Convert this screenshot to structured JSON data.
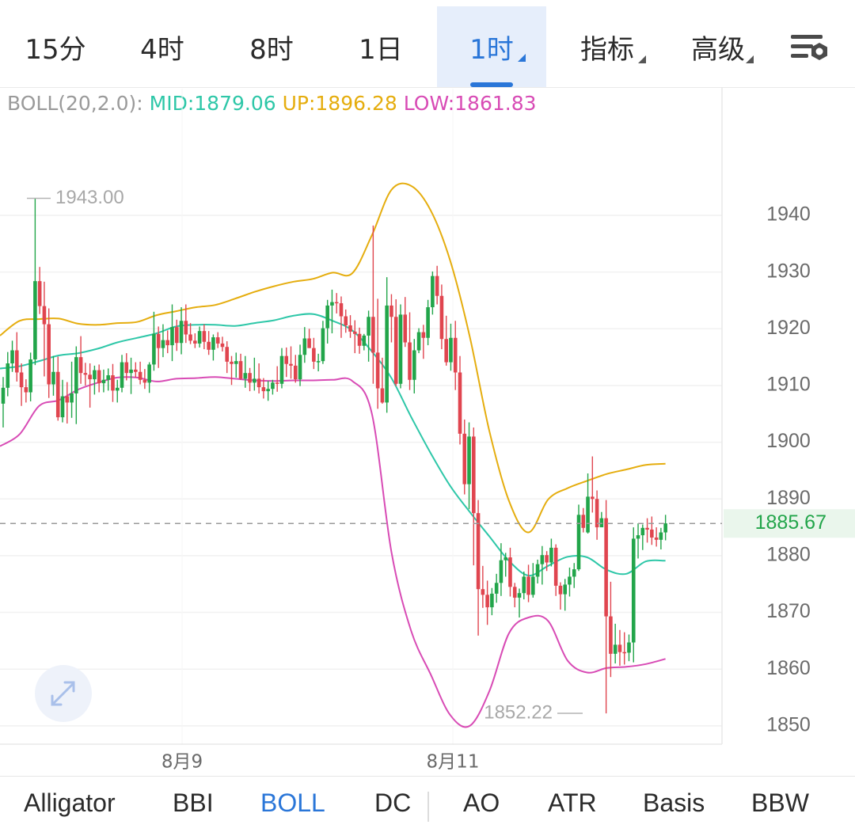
{
  "timeframe_tabs": [
    {
      "label": "15分"
    },
    {
      "label": "4时"
    },
    {
      "label": "8时"
    },
    {
      "label": "1日"
    },
    {
      "label": "1时",
      "active": true
    },
    {
      "label": "指标"
    },
    {
      "label": "高级"
    }
  ],
  "settings_icon": "chart-settings-gear-icon",
  "indicator_legend": {
    "name": "BOLL(20,2.0):",
    "mid": "MID:1879.06",
    "up": "UP:1896.28",
    "low": "LOW:1861.83"
  },
  "colors": {
    "up_candle": "#22a54a",
    "down_candle": "#e0454f",
    "mid_line": "#2ec7a8",
    "upper_band": "#e5ad0e",
    "lower_band": "#d84bb5",
    "active_tab": "#2a76d8",
    "last_price": "#22a54a"
  },
  "chart_data": {
    "type": "candlestick",
    "interval": "1时",
    "ylim": [
      1846,
      1954
    ],
    "y_ticks": [
      "1940",
      "1930",
      "1920",
      "1910",
      "1900",
      "1890",
      "1880",
      "1870",
      "1860",
      "1850"
    ],
    "x_labels": [
      "8月9",
      "8月11"
    ],
    "high_marker": "1943.00",
    "low_marker": "1852.22",
    "last_price": "1885.67",
    "candles": [
      [
        1906.8,
        1911.5,
        1902.6,
        1909.6
      ],
      [
        1909.6,
        1915.9,
        1908.1,
        1913.9
      ],
      [
        1913.9,
        1917.9,
        1912.4,
        1916.2
      ],
      [
        1916.2,
        1919.4,
        1910.7,
        1912.3
      ],
      [
        1912.3,
        1913.9,
        1906.4,
        1909.7
      ],
      [
        1909.7,
        1911.1,
        1907.0,
        1908.8
      ],
      [
        1908.8,
        1915.8,
        1907.2,
        1914.6
      ],
      [
        1914.6,
        1943.0,
        1913.6,
        1928.4
      ],
      [
        1928.4,
        1930.9,
        1922.6,
        1924.0
      ],
      [
        1924.0,
        1928.3,
        1911.6,
        1920.8
      ],
      [
        1920.8,
        1923.6,
        1907.8,
        1910.2
      ],
      [
        1910.2,
        1915.2,
        1908.2,
        1912.4
      ],
      [
        1912.4,
        1915.1,
        1903.8,
        1904.4
      ],
      [
        1904.4,
        1911.0,
        1903.5,
        1908.1
      ],
      [
        1908.1,
        1910.6,
        1903.3,
        1907.0
      ],
      [
        1907.0,
        1914.2,
        1904.3,
        1908.6
      ],
      [
        1908.6,
        1916.9,
        1903.2,
        1915.0
      ],
      [
        1915.0,
        1918.7,
        1910.3,
        1912.2
      ],
      [
        1912.2,
        1914.0,
        1910.0,
        1911.9
      ],
      [
        1911.9,
        1913.9,
        1906.1,
        1911.1
      ],
      [
        1911.1,
        1913.5,
        1908.4,
        1912.7
      ],
      [
        1912.7,
        1913.7,
        1908.8,
        1910.4
      ],
      [
        1910.4,
        1912.8,
        1908.8,
        1911.0
      ],
      [
        1911.0,
        1913.0,
        1909.1,
        1911.8
      ],
      [
        1911.8,
        1913.8,
        1907.1,
        1909.1
      ],
      [
        1909.1,
        1911.0,
        1907.0,
        1909.6
      ],
      [
        1909.6,
        1915.4,
        1908.8,
        1914.1
      ],
      [
        1914.1,
        1915.7,
        1910.9,
        1912.2
      ],
      [
        1912.2,
        1914.9,
        1908.5,
        1912.8
      ],
      [
        1912.8,
        1914.1,
        1911.4,
        1912.4
      ],
      [
        1912.4,
        1914.2,
        1910.2,
        1911.0
      ],
      [
        1911.0,
        1912.9,
        1909.4,
        1910.5
      ],
      [
        1910.5,
        1914.1,
        1908.7,
        1913.7
      ],
      [
        1913.7,
        1923.0,
        1912.6,
        1919.1
      ],
      [
        1919.1,
        1920.4,
        1913.1,
        1916.6
      ],
      [
        1916.6,
        1920.8,
        1915.0,
        1918.0
      ],
      [
        1918.0,
        1919.7,
        1915.7,
        1917.1
      ],
      [
        1917.1,
        1924.3,
        1914.3,
        1920.3
      ],
      [
        1920.3,
        1921.6,
        1916.1,
        1917.5
      ],
      [
        1917.5,
        1923.8,
        1915.5,
        1921.4
      ],
      [
        1921.4,
        1924.3,
        1917.5,
        1919.0
      ],
      [
        1919.0,
        1921.0,
        1917.3,
        1917.9
      ],
      [
        1917.9,
        1919.2,
        1916.6,
        1917.4
      ],
      [
        1917.4,
        1920.4,
        1916.7,
        1919.6
      ],
      [
        1919.6,
        1920.8,
        1916.4,
        1917.7
      ],
      [
        1917.7,
        1919.6,
        1915.4,
        1916.3
      ],
      [
        1916.3,
        1919.0,
        1914.4,
        1918.5
      ],
      [
        1918.5,
        1919.4,
        1916.6,
        1917.4
      ],
      [
        1917.4,
        1918.6,
        1916.0,
        1916.8
      ],
      [
        1916.8,
        1917.8,
        1912.2,
        1914.2
      ],
      [
        1914.2,
        1915.2,
        1910.1,
        1913.8
      ],
      [
        1913.8,
        1915.8,
        1911.4,
        1914.3
      ],
      [
        1914.3,
        1915.6,
        1911.0,
        1911.2
      ],
      [
        1911.2,
        1915.2,
        1909.6,
        1912.2
      ],
      [
        1912.2,
        1913.1,
        1909.0,
        1910.5
      ],
      [
        1910.5,
        1914.9,
        1909.1,
        1911.2
      ],
      [
        1911.2,
        1913.9,
        1908.6,
        1909.7
      ],
      [
        1909.7,
        1911.3,
        1907.7,
        1909.0
      ],
      [
        1909.0,
        1910.8,
        1907.3,
        1909.4
      ],
      [
        1909.4,
        1911.0,
        1908.4,
        1910.5
      ],
      [
        1910.5,
        1913.4,
        1908.9,
        1910.3
      ],
      [
        1910.3,
        1916.6,
        1909.5,
        1915.2
      ],
      [
        1915.2,
        1916.7,
        1911.5,
        1913.8
      ],
      [
        1913.8,
        1916.9,
        1911.2,
        1913.5
      ],
      [
        1913.5,
        1915.4,
        1910.5,
        1911.1
      ],
      [
        1911.1,
        1917.2,
        1909.9,
        1915.4
      ],
      [
        1915.4,
        1920.3,
        1914.0,
        1918.3
      ],
      [
        1918.3,
        1920.0,
        1916.6,
        1916.6
      ],
      [
        1916.6,
        1918.4,
        1912.9,
        1914.2
      ],
      [
        1914.2,
        1915.6,
        1912.5,
        1914.3
      ],
      [
        1914.3,
        1921.4,
        1913.8,
        1920.1
      ],
      [
        1920.1,
        1925.1,
        1917.4,
        1924.1
      ],
      [
        1924.1,
        1926.9,
        1919.2,
        1924.7
      ],
      [
        1924.7,
        1926.3,
        1922.7,
        1924.5
      ],
      [
        1924.5,
        1925.7,
        1918.4,
        1922.2
      ],
      [
        1922.2,
        1923.4,
        1919.3,
        1920.6
      ],
      [
        1920.6,
        1922.4,
        1918.4,
        1919.5
      ],
      [
        1919.5,
        1921.5,
        1915.7,
        1919.1
      ],
      [
        1919.1,
        1920.2,
        1915.6,
        1917.0
      ],
      [
        1917.0,
        1919.1,
        1916.2,
        1918.8
      ],
      [
        1918.8,
        1923.2,
        1914.2,
        1922.1
      ],
      [
        1922.1,
        1938.2,
        1910.3,
        1915.8
      ],
      [
        1915.8,
        1925.3,
        1905.9,
        1909.5
      ],
      [
        1909.5,
        1914.9,
        1906.8,
        1907.0
      ],
      [
        1907.0,
        1929.1,
        1905.2,
        1924.1
      ],
      [
        1924.1,
        1926.1,
        1917.6,
        1922.1
      ],
      [
        1922.1,
        1925.2,
        1909.9,
        1910.3
      ],
      [
        1910.3,
        1924.3,
        1909.5,
        1922.5
      ],
      [
        1922.5,
        1925.6,
        1916.8,
        1917.6
      ],
      [
        1917.6,
        1922.9,
        1909.2,
        1911.0
      ],
      [
        1911.0,
        1918.2,
        1908.6,
        1916.2
      ],
      [
        1916.2,
        1920.1,
        1915.7,
        1919.4
      ],
      [
        1919.4,
        1920.7,
        1914.7,
        1918.4
      ],
      [
        1918.4,
        1925.1,
        1917.1,
        1923.8
      ],
      [
        1923.8,
        1930.1,
        1922.5,
        1929.3
      ],
      [
        1929.3,
        1931.1,
        1924.3,
        1925.8
      ],
      [
        1925.8,
        1927.8,
        1916.4,
        1918.2
      ],
      [
        1918.2,
        1922.3,
        1913.5,
        1914.1
      ],
      [
        1914.1,
        1920.9,
        1912.6,
        1918.4
      ],
      [
        1918.4,
        1921.4,
        1909.2,
        1912.3
      ],
      [
        1912.3,
        1915.2,
        1899.6,
        1901.5
      ],
      [
        1901.5,
        1904.0,
        1890.8,
        1892.6
      ],
      [
        1892.6,
        1903.5,
        1888.2,
        1901.0
      ],
      [
        1901.0,
        1902.6,
        1878.3,
        1887.5
      ],
      [
        1887.5,
        1889.8,
        1865.9,
        1874.1
      ],
      [
        1874.1,
        1878.2,
        1870.8,
        1873.1
      ],
      [
        1873.1,
        1875.6,
        1867.8,
        1870.9
      ],
      [
        1870.9,
        1874.3,
        1869.5,
        1873.3
      ],
      [
        1873.3,
        1876.8,
        1871.7,
        1875.2
      ],
      [
        1875.2,
        1882.2,
        1872.9,
        1879.2
      ],
      [
        1879.2,
        1880.5,
        1876.3,
        1879.7
      ],
      [
        1879.7,
        1881.4,
        1872.8,
        1874.5
      ],
      [
        1874.5,
        1875.2,
        1870.9,
        1872.6
      ],
      [
        1872.6,
        1874.2,
        1869.1,
        1873.4
      ],
      [
        1873.4,
        1877.2,
        1872.3,
        1876.3
      ],
      [
        1876.3,
        1878.4,
        1871.8,
        1873.1
      ],
      [
        1873.1,
        1878.7,
        1872.6,
        1876.3
      ],
      [
        1876.3,
        1879.3,
        1875.1,
        1878.5
      ],
      [
        1878.5,
        1881.7,
        1874.9,
        1880.1
      ],
      [
        1880.1,
        1880.8,
        1877.3,
        1878.8
      ],
      [
        1878.8,
        1883.0,
        1878.1,
        1881.4
      ],
      [
        1881.4,
        1882.0,
        1872.9,
        1874.7
      ],
      [
        1874.7,
        1875.3,
        1870.5,
        1873.2
      ],
      [
        1873.2,
        1875.9,
        1870.3,
        1874.9
      ],
      [
        1874.9,
        1877.9,
        1872.8,
        1876.3
      ],
      [
        1876.3,
        1878.7,
        1874.3,
        1877.6
      ],
      [
        1877.6,
        1889.0,
        1877.3,
        1887.2
      ],
      [
        1887.2,
        1888.4,
        1884.1,
        1884.9
      ],
      [
        1884.1,
        1894.5,
        1883.9,
        1890.4
      ],
      [
        1890.4,
        1897.5,
        1887.6,
        1890.0
      ],
      [
        1890.0,
        1891.5,
        1882.8,
        1885.0
      ],
      [
        1885.0,
        1887.7,
        1885.4,
        1886.6
      ],
      [
        1886.6,
        1889.8,
        1852.2,
        1869.3
      ],
      [
        1869.3,
        1875.4,
        1858.6,
        1862.7
      ],
      [
        1862.7,
        1868.0,
        1861.0,
        1864.3
      ],
      [
        1864.3,
        1866.9,
        1860.6,
        1863.0
      ],
      [
        1863.0,
        1866.5,
        1860.8,
        1862.9
      ],
      [
        1862.9,
        1866.1,
        1861.4,
        1864.7
      ],
      [
        1864.7,
        1885.0,
        1861.2,
        1883.0
      ],
      [
        1883.0,
        1885.7,
        1879.5,
        1883.6
      ],
      [
        1883.6,
        1885.5,
        1881.0,
        1884.9
      ],
      [
        1884.9,
        1886.6,
        1882.3,
        1884.6
      ],
      [
        1884.6,
        1886.9,
        1881.9,
        1883.2
      ],
      [
        1883.2,
        1885.0,
        1881.6,
        1882.8
      ],
      [
        1882.8,
        1884.9,
        1881.1,
        1884.1
      ],
      [
        1884.1,
        1887.2,
        1882.7,
        1885.7
      ]
    ],
    "boll_mid": [
      1913.0,
      1913.4,
      1914.3,
      1915.3,
      1915.7,
      1916.5,
      1917.6,
      1918.4,
      1919.2,
      1920.4,
      1920.7,
      1920.7,
      1920.5,
      1921.0,
      1921.5,
      1922.3,
      1922.6,
      1921.4,
      1919.7,
      1916.0,
      1911.3,
      1904.5,
      1898.1,
      1892.3,
      1887.7,
      1883.4,
      1879.1,
      1876.5,
      1878.2,
      1879.8,
      1879.7,
      1877.5,
      1876.8,
      1879.0,
      1879.1
    ],
    "boll_up": [
      1918.8,
      1921.4,
      1921.7,
      1921.8,
      1920.9,
      1920.7,
      1921.0,
      1921.2,
      1922.4,
      1923.1,
      1923.8,
      1924.2,
      1925.3,
      1926.5,
      1927.5,
      1928.3,
      1928.8,
      1929.9,
      1929.8,
      1936.5,
      1944.5,
      1945.2,
      1940.9,
      1932.0,
      1918.6,
      1902.0,
      1889.7,
      1884.1,
      1889.9,
      1891.9,
      1893.2,
      1894.4,
      1895.2,
      1896.0,
      1896.2
    ],
    "boll_low": [
      1899.3,
      1901.4,
      1906.4,
      1907.4,
      1909.3,
      1910.5,
      1911.4,
      1911.4,
      1910.7,
      1911.2,
      1911.3,
      1911.5,
      1911.2,
      1910.9,
      1910.8,
      1910.9,
      1910.9,
      1911.0,
      1910.8,
      1905.0,
      1880.6,
      1866.8,
      1859.1,
      1851.9,
      1850.0,
      1856.1,
      1866.3,
      1869.1,
      1868.5,
      1861.5,
      1859.4,
      1860.2,
      1860.4,
      1860.9,
      1861.8
    ]
  },
  "bottom_tabs": [
    {
      "label": "Alligator"
    },
    {
      "label": "BBI"
    },
    {
      "label": "BOLL",
      "active": true
    },
    {
      "label": "DC"
    },
    {
      "label": "AO"
    },
    {
      "label": "ATR"
    },
    {
      "label": "Basis"
    },
    {
      "label": "BBW"
    }
  ],
  "expand_icon": "expand-arrows-icon"
}
